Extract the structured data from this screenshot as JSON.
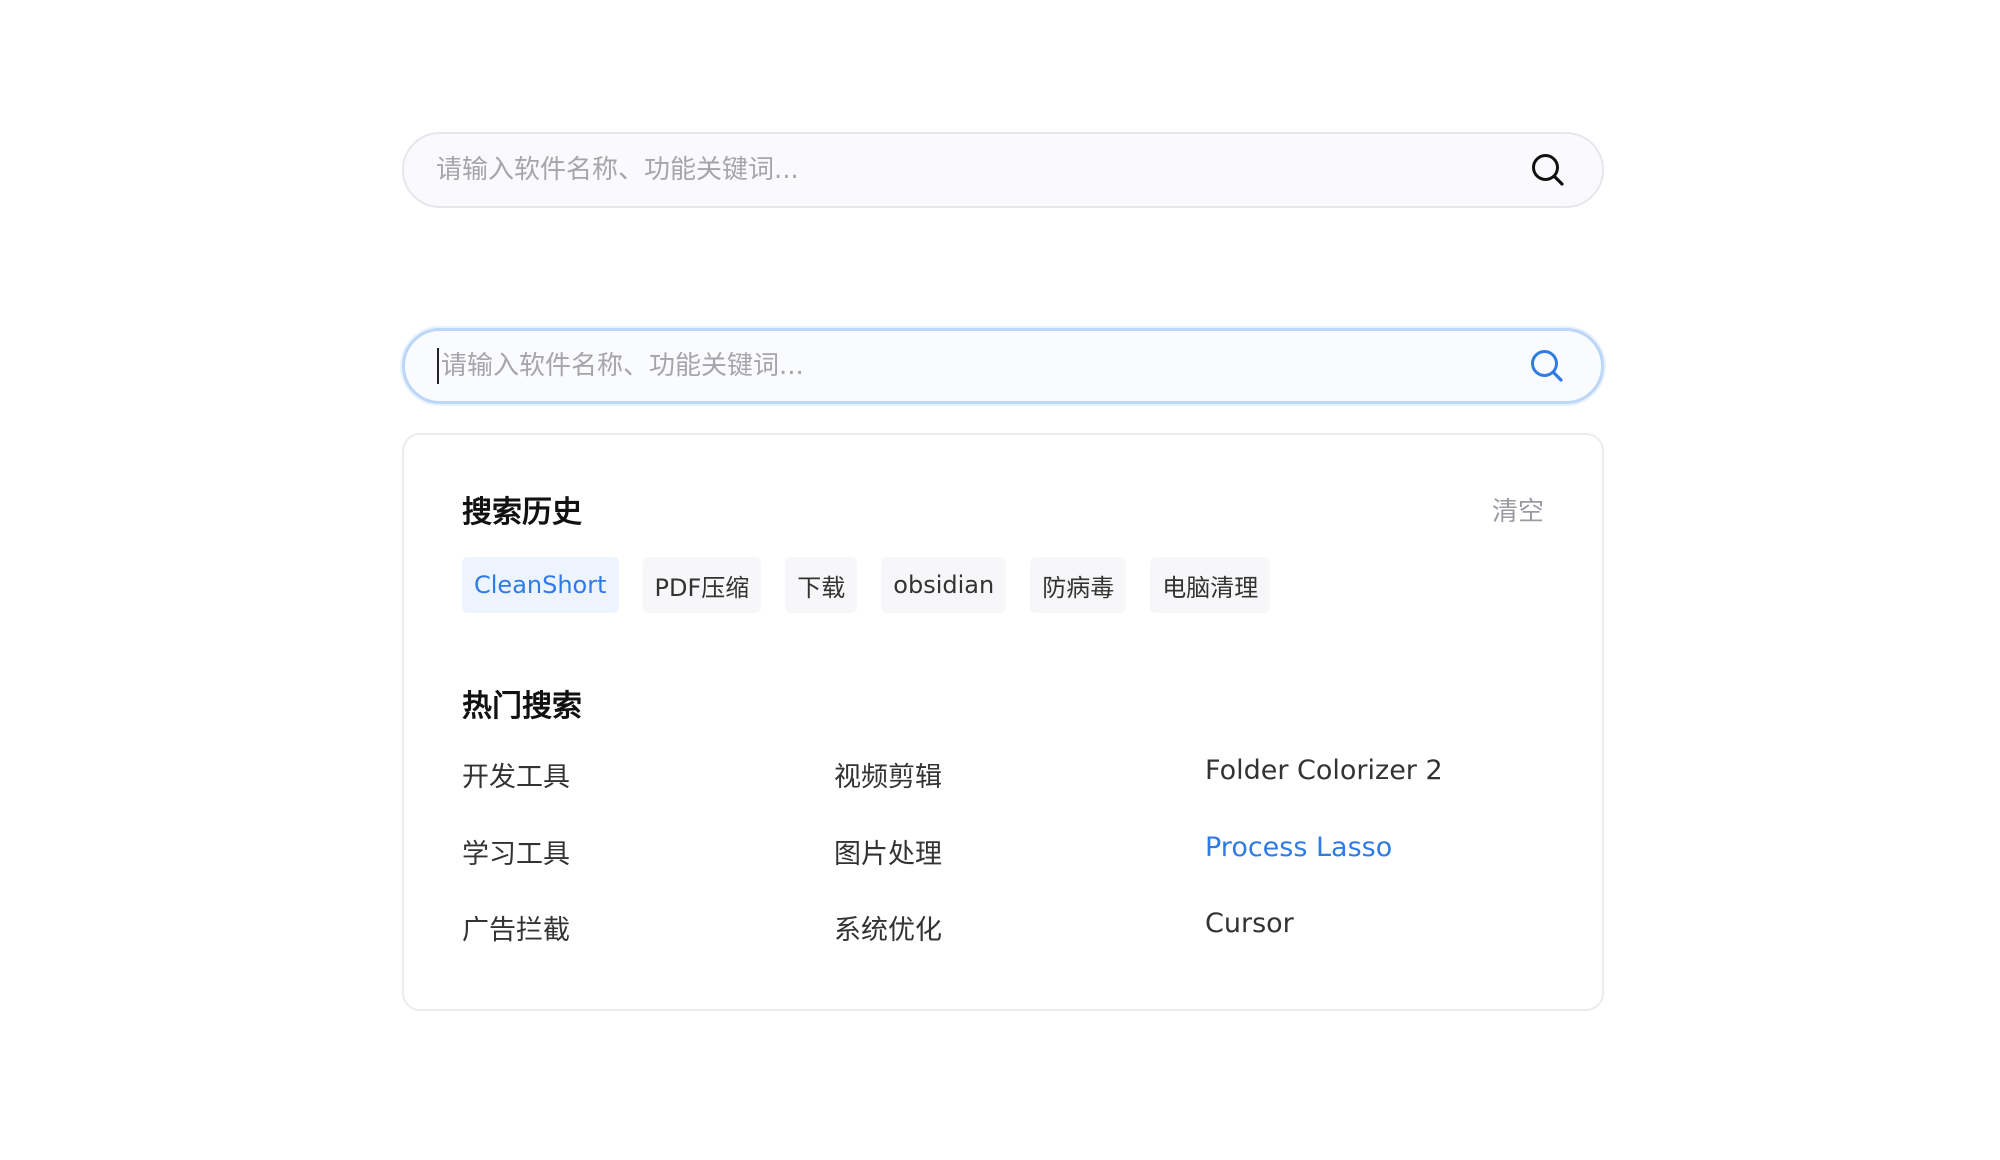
{
  "search_idle": {
    "placeholder": "请输入软件名称、功能关键词..."
  },
  "search_focused": {
    "placeholder": "请输入软件名称、功能关键词..."
  },
  "history": {
    "title": "搜索历史",
    "clear_label": "清空",
    "items": [
      "CleanShort",
      "PDF压缩",
      "下载",
      "obsidian",
      "防病毒",
      "电脑清理"
    ]
  },
  "hot": {
    "title": "热门搜索",
    "items": [
      "开发工具",
      "视频剪辑",
      "Folder Colorizer 2",
      "学习工具",
      "图片处理",
      "Process Lasso",
      "广告拦截",
      "系统优化",
      "Cursor"
    ]
  },
  "colors": {
    "accent": "#2f7be6",
    "focus_border": "#bcd6f7",
    "text": "#333333",
    "muted": "#a7a4ab"
  },
  "icons": {
    "search_idle": "search-icon",
    "search_focused": "search-icon"
  }
}
